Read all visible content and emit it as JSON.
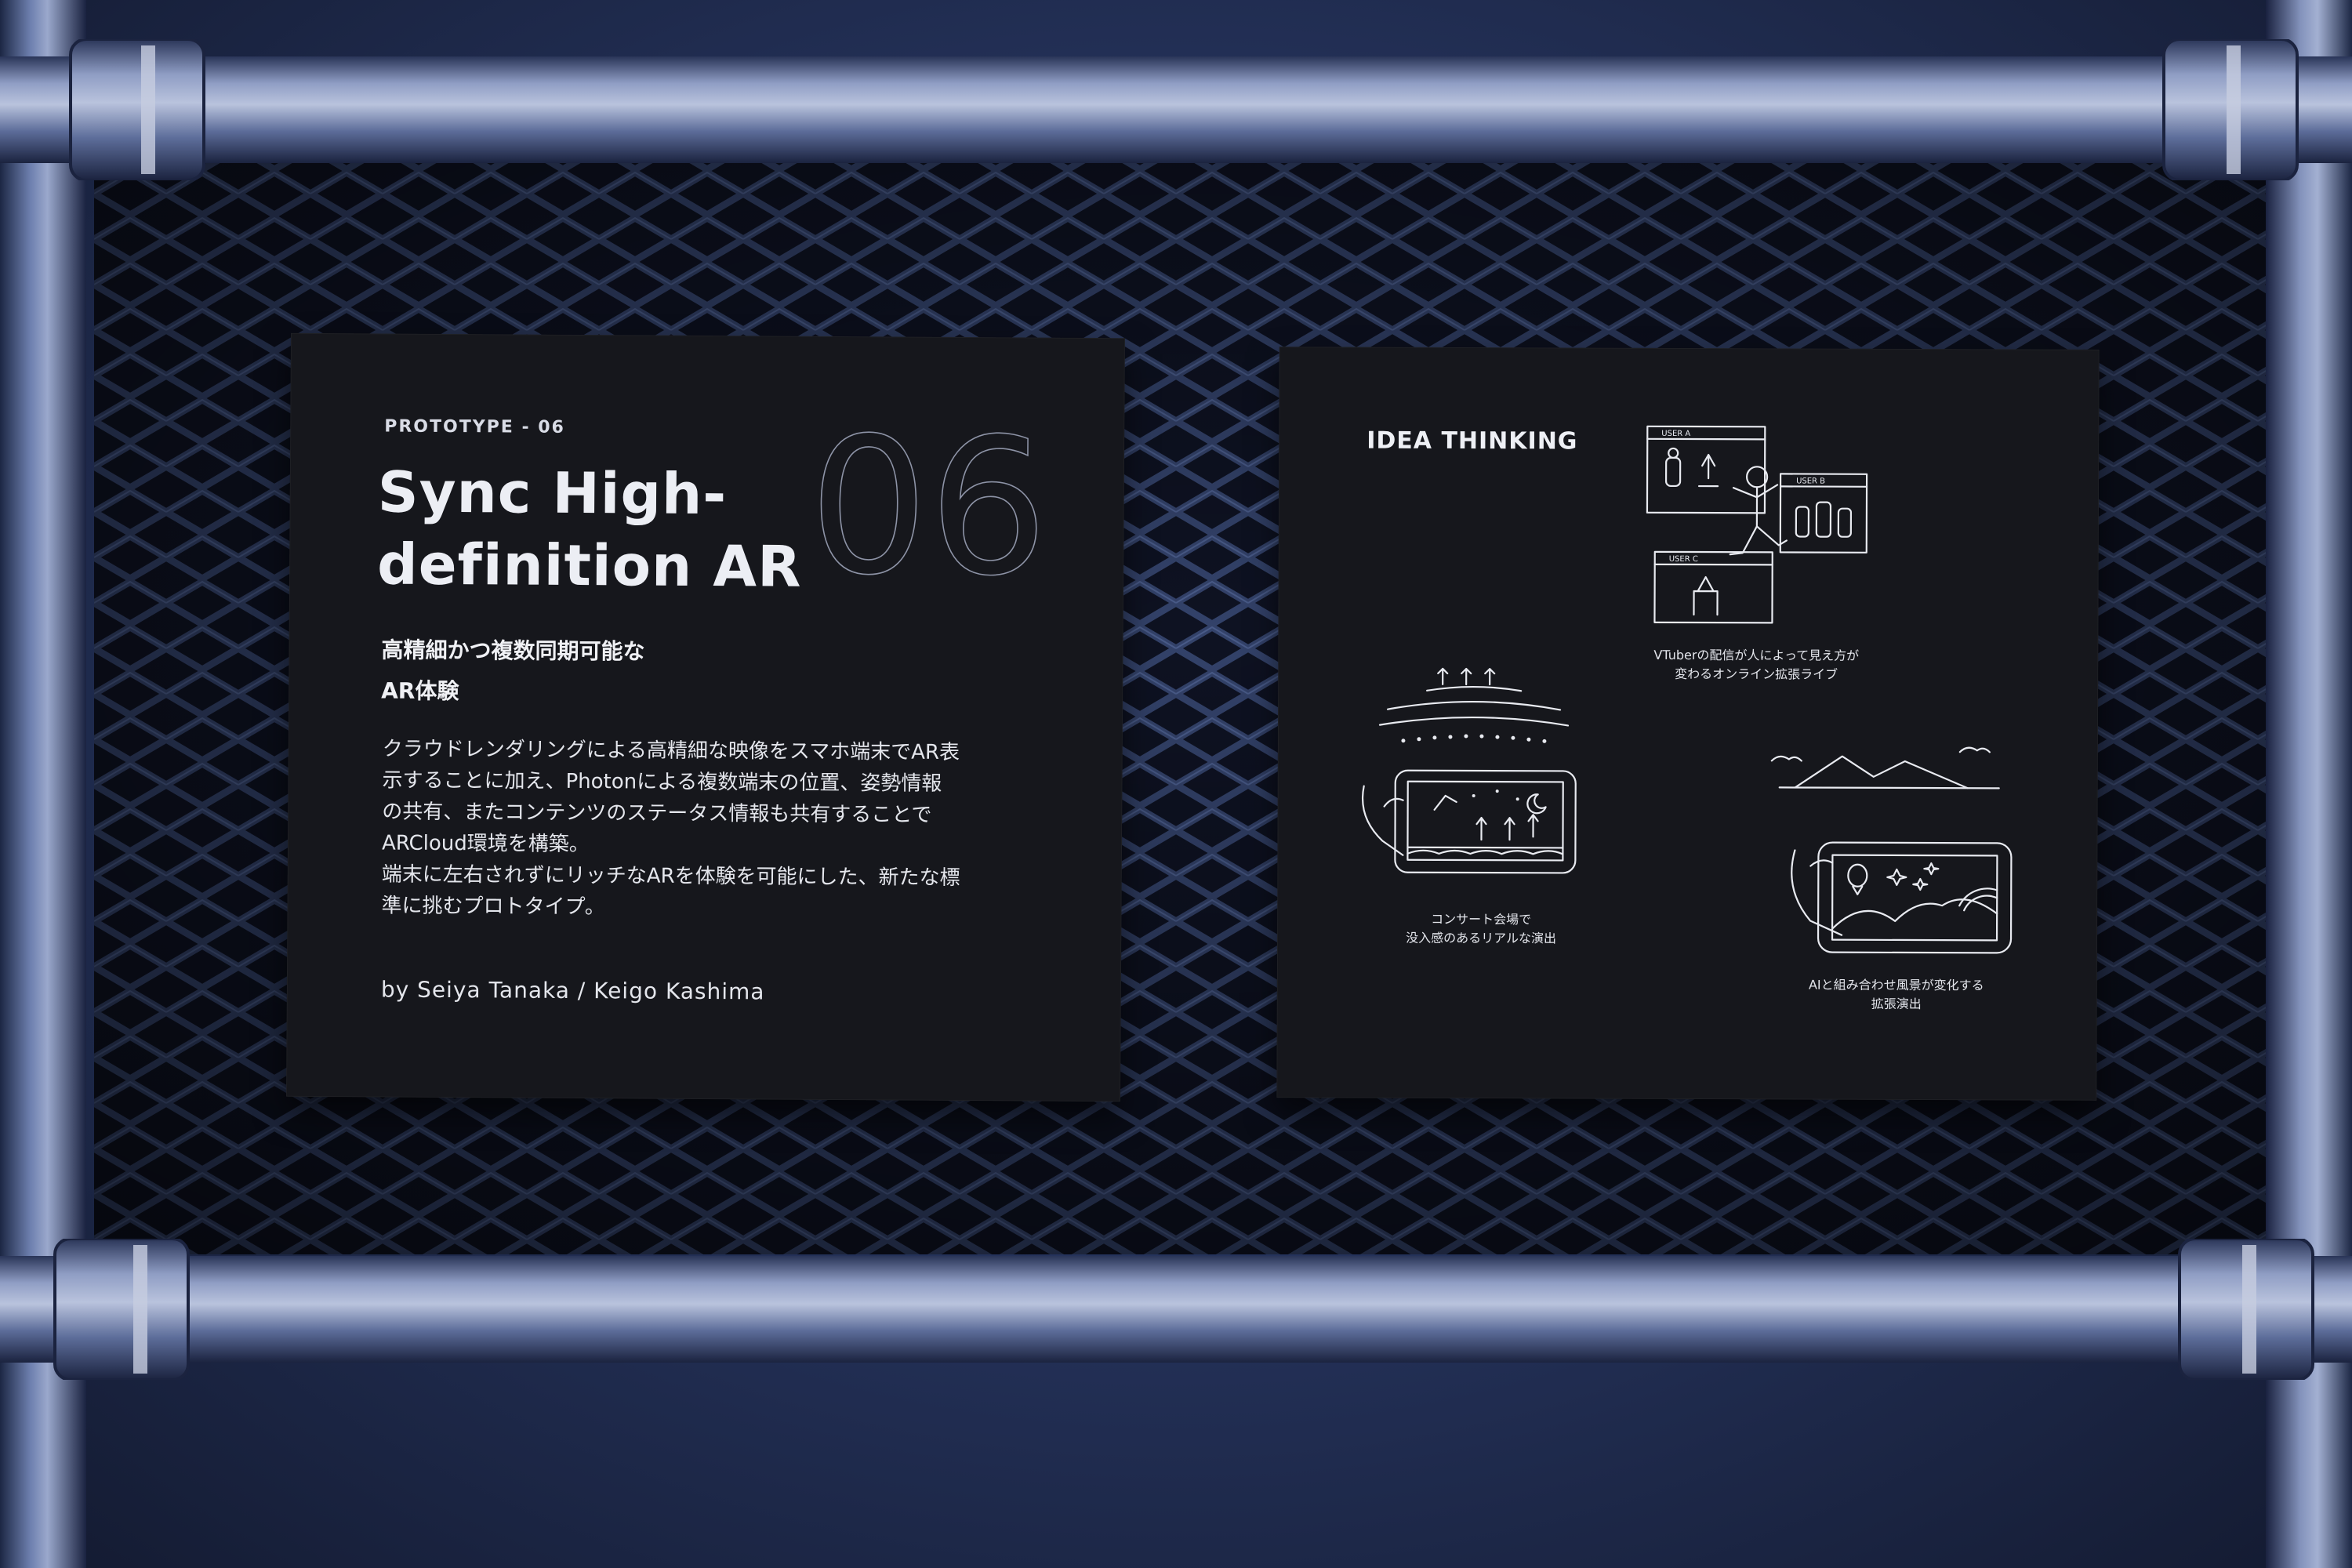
{
  "left_panel": {
    "proto_label": "PROTOTYPE - 06",
    "title_line1": "Sync High-",
    "title_line2": "definition AR",
    "number": "06",
    "jp_subtitle_line1": "高精細かつ複数同期可能な",
    "jp_subtitle_line2": "AR体験",
    "description_lines": [
      "クラウドレンダリングによる高精細な映像をスマホ端末でAR表",
      "示することに加え、Photonによる複数端末の位置、姿勢情報",
      "の共有、またコンテンツのステータス情報も共有することで",
      "ARCloud環境を構築。",
      "端末に左右されずにリッチなARを体験を可能にした、新たな標",
      "準に挑むプロトタイプ。"
    ],
    "byline": "by Seiya Tanaka / Keigo Kashima"
  },
  "right_panel": {
    "title": "IDEA THINKING",
    "labels": {
      "user_a": "USER A",
      "user_b": "USER B",
      "user_c": "USER C"
    },
    "captions": [
      {
        "line1": "VTuberの配信が人によって見え方が",
        "line2": "変わるオンライン拡張ライブ"
      },
      {
        "line1": "コンサート会場で",
        "line2": "没入感のあるリアルな演出"
      },
      {
        "line1": "AIと組み合わせ風景が変化する",
        "line2": "拡張演出"
      }
    ]
  },
  "colors": {
    "panel": "#16171c",
    "line_art": "#e8eaf0",
    "background": "#25335c"
  }
}
